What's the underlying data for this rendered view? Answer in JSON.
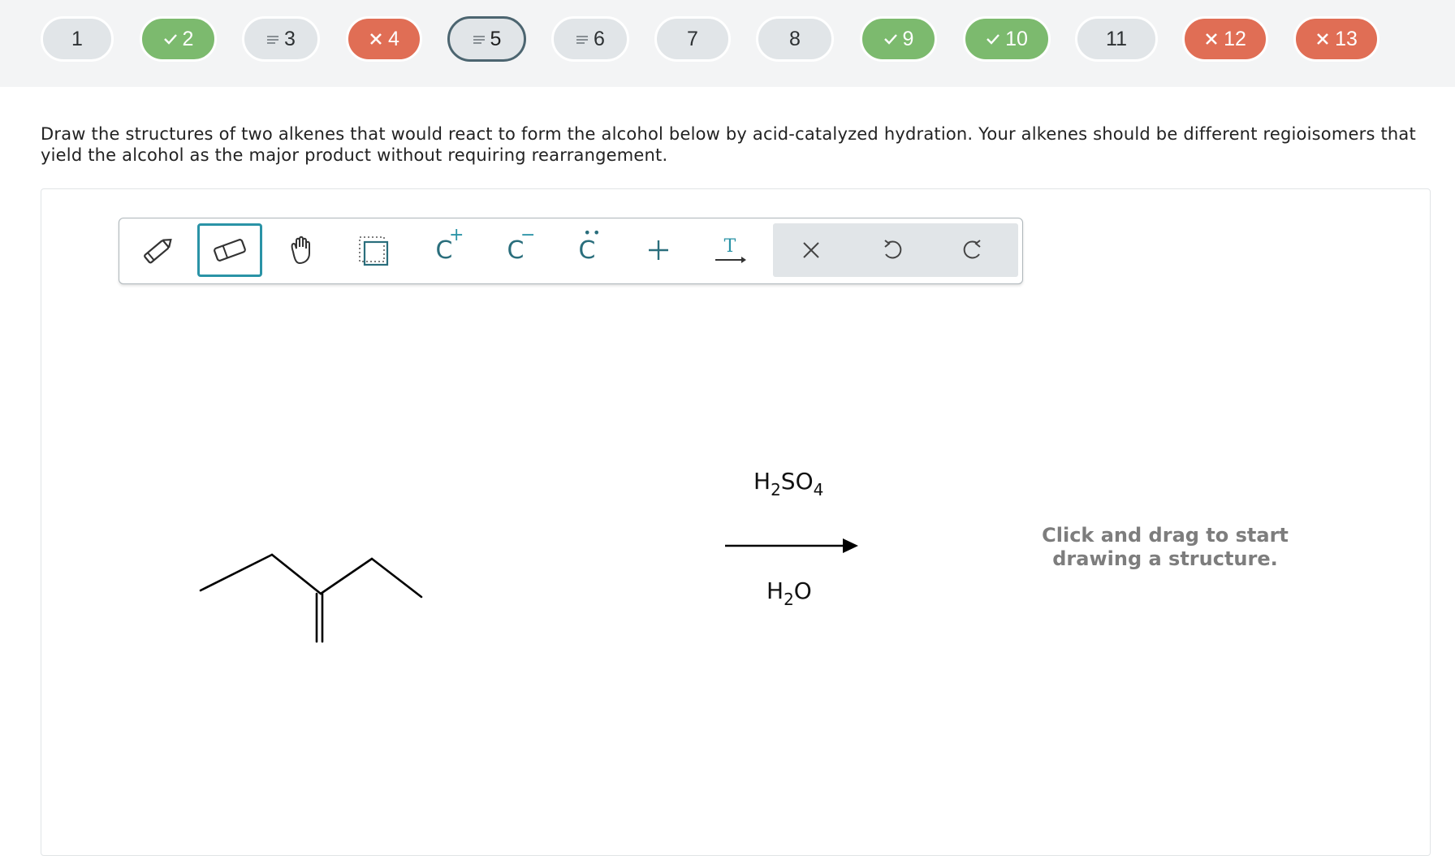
{
  "questions": [
    {
      "label": "1",
      "status": "neutral",
      "symbol": ""
    },
    {
      "label": "2",
      "status": "correct",
      "symbol": "check"
    },
    {
      "label": "3",
      "status": "neutral",
      "symbol": "equals"
    },
    {
      "label": "4",
      "status": "wrong",
      "symbol": "x"
    },
    {
      "label": "5",
      "status": "current",
      "symbol": "equals"
    },
    {
      "label": "6",
      "status": "neutral",
      "symbol": "equals"
    },
    {
      "label": "7",
      "status": "neutral",
      "symbol": ""
    },
    {
      "label": "8",
      "status": "neutral",
      "symbol": ""
    },
    {
      "label": "9",
      "status": "correct",
      "symbol": "check"
    },
    {
      "label": "10",
      "status": "correct",
      "symbol": "check"
    },
    {
      "label": "11",
      "status": "neutral",
      "symbol": ""
    },
    {
      "label": "12",
      "status": "wrong",
      "symbol": "x"
    },
    {
      "label": "13",
      "status": "wrong",
      "symbol": "x"
    }
  ],
  "prompt": "Draw the structures of two alkenes that would react to form the alcohol below by acid-catalyzed hydration. Your alkenes should be different regioisomers that yield the alcohol as the major product without requiring rearrangement.",
  "toolbar": {
    "tools": [
      {
        "name": "pencil-icon",
        "selected": false
      },
      {
        "name": "eraser-icon",
        "selected": true
      },
      {
        "name": "hand-icon",
        "selected": false
      },
      {
        "name": "select-icon",
        "selected": false
      },
      {
        "name": "positive-charge-icon",
        "selected": false
      },
      {
        "name": "negative-charge-icon",
        "selected": false
      },
      {
        "name": "lone-pair-icon",
        "selected": false
      },
      {
        "name": "plus-icon",
        "selected": false
      },
      {
        "name": "text-arrow-icon",
        "selected": false
      },
      {
        "name": "clear-icon",
        "selected": false
      },
      {
        "name": "undo-icon",
        "selected": false
      },
      {
        "name": "redo-icon",
        "selected": false
      }
    ],
    "charge_glyph": "C",
    "plus_sign": "+",
    "minus_sign": "−",
    "text_tool_letter": "T"
  },
  "reaction": {
    "reagent_above": {
      "main": "H",
      "sub1": "2",
      "mid": "SO",
      "sub2": "4"
    },
    "reagent_below": {
      "main": "H",
      "sub1": "2",
      "end": "O"
    }
  },
  "canvas_hint": "Click and drag to start drawing a structure.",
  "colors": {
    "correct": "#7cba6e",
    "wrong": "#e06e55",
    "neutral": "#e1e5e8",
    "accent": "#2a93a6",
    "current_border": "#4c6570"
  }
}
